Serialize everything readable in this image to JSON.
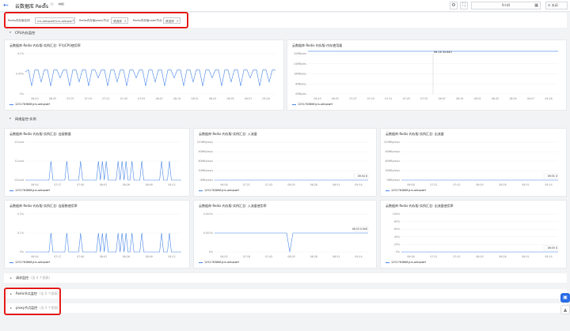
{
  "header": {
    "back_icon": "←",
    "title": "云数据库 Redis",
    "title_caret": "▾",
    "star_icon": "☆",
    "share_icon": "⋘",
    "settings_icon": "⚙",
    "fullscreen_icon": "⛶",
    "time_range": "9小时",
    "calendar_icon": "▦",
    "refresh_label": "关闭"
  },
  "filters": [
    {
      "label": "Redis内存版实例",
      "value": "crs-aetqxwtf(crs-aetqxw..."
    },
    {
      "label": "Redis内存版proxy节点",
      "value": "请选择"
    },
    {
      "label": "Redis内存版node节点",
      "value": "请选择"
    }
  ],
  "sections": {
    "cpu": {
      "title": "CPU内存监控",
      "arrow": "▾"
    },
    "net": {
      "title": "网络监控-实例",
      "arrow": "▾"
    },
    "request": {
      "title": "请求监控",
      "hint": "(含 4 个图表)",
      "arrow": "▸"
    },
    "redis_node": {
      "title": "Redis节点监控",
      "hint": "(含 0 个图表)",
      "arrow": "▸"
    },
    "proxy_node": {
      "title": "proxy节点监控",
      "hint": "(含 0 个图表)",
      "arrow": "▸"
    }
  },
  "legend_label": "1251763868|crs-aetqxwtf",
  "colors": {
    "line": "#4e8ae8",
    "accent": "#2b6de5",
    "red": "#e5221e"
  },
  "chart_data": [
    {
      "id": "c1",
      "type": "line",
      "title": "云数据库-Redis-内存版-实例汇总: 平均CPU使用率",
      "yticks": [
        "0%",
        "0.05%",
        "0.1%"
      ],
      "ylim": [
        0,
        0.1
      ],
      "xticks": [
        "06:43",
        "06:55",
        "07:07",
        "07:19",
        "07:31",
        "07:43",
        "07:55",
        "08:07",
        "08:19",
        "08:31",
        "08:43",
        "08:55",
        "09:07",
        "09:18"
      ],
      "series": [
        {
          "values": [
            0.055,
            0.06,
            0.02,
            0.06,
            0.06,
            0.03,
            0.06,
            0.06,
            0.02,
            0.06,
            0.06,
            0.04,
            0.06,
            0.06,
            0.02,
            0.06,
            0.06,
            0.03,
            0.06,
            0.06,
            0.02,
            0.06,
            0.06,
            0.04,
            0.06,
            0.06,
            0.02,
            0.06,
            0.06,
            0.03,
            0.06,
            0.06,
            0.02,
            0.06,
            0.06,
            0.04,
            0.06,
            0.06,
            0.02,
            0.06,
            0.06,
            0.03,
            0.06,
            0.06,
            0.02,
            0.06,
            0.06,
            0.04,
            0.06,
            0.06,
            0.02,
            0.06,
            0.06,
            0.03,
            0.06,
            0.06,
            0.02,
            0.06,
            0.06,
            0.04,
            0.06,
            0.06,
            0.02,
            0.06,
            0.06,
            0.03,
            0.06,
            0.06,
            0.02,
            0.06,
            0.06,
            0.04,
            0.06,
            0.06,
            0.02,
            0.06,
            0.06,
            0.03,
            0.06,
            0.06
          ]
        }
      ]
    },
    {
      "id": "c2",
      "type": "line",
      "title": "云数据库-Redis-内存版-内存使用量",
      "yticks": [
        "0MBytes",
        "8MBytes",
        "16MBytes",
        "24MBytes",
        "32MBytes"
      ],
      "ylim": [
        0,
        32
      ],
      "xticks": [
        "06:43",
        "06:55",
        "07:07",
        "07:19",
        "07:31",
        "07:43",
        "07:55",
        "08:07",
        "08:19",
        "08:31",
        "08:43",
        "08:55",
        "09:07",
        "09:18"
      ],
      "tooltip": "08:18 34.840",
      "cursor_x": 0.5,
      "series": [
        {
          "values": [
            34.8,
            34.8,
            34.8,
            34.8,
            34.8,
            34.8,
            34.8,
            34.8,
            34.8,
            34.8,
            34.8,
            34.8,
            34.8,
            34.8,
            34.8,
            34.8,
            34.8,
            34.8,
            34.8,
            34.8
          ]
        }
      ]
    },
    {
      "id": "c3",
      "type": "line",
      "title": "云数据库-Redis-内存版-实例汇总: 连接数量",
      "yticks": [
        "0Count",
        "1Count",
        "2Count"
      ],
      "ylim": [
        0,
        2
      ],
      "xticks": [
        "06:54",
        "07:17",
        "07:40",
        "08:03",
        "08:26",
        "08:49",
        "09:12"
      ],
      "series": [
        {
          "values": [
            0,
            0,
            0,
            0,
            0,
            0,
            0,
            0,
            0,
            0,
            0,
            0,
            0,
            1,
            0,
            0,
            0,
            0,
            0,
            0,
            0,
            1,
            0,
            0,
            0,
            0,
            0,
            0,
            1,
            0,
            0,
            0,
            0,
            0,
            0,
            0,
            0,
            1,
            0,
            1,
            0,
            1,
            0,
            0,
            0,
            0,
            0,
            1,
            0,
            1,
            0,
            1,
            0,
            0,
            1,
            0,
            0,
            0,
            0,
            1,
            0,
            0,
            0,
            0,
            0,
            0,
            0,
            0,
            0,
            1,
            0,
            0,
            0,
            1,
            0,
            0,
            0,
            0,
            0,
            0
          ]
        }
      ]
    },
    {
      "id": "c4",
      "type": "line",
      "title": "云数据库-Redis-内存版-实例汇总: 入流量",
      "yticks": [
        "0MBytes/s",
        "30MBytes/s",
        "60MBytes/s",
        "90MBytes/s",
        "120MBytes/s"
      ],
      "ylim": [
        0,
        120
      ],
      "xticks": [
        "06:58",
        "07:21",
        "07:42",
        "08:05",
        "08:28",
        "08:51",
        "09:14"
      ],
      "end_label": "09:34 0",
      "series": [
        {
          "values": [
            0,
            0,
            0,
            0,
            0,
            0,
            0,
            0,
            0,
            0,
            0,
            0,
            0,
            0,
            0,
            0,
            0,
            0,
            0,
            0
          ]
        }
      ]
    },
    {
      "id": "c5",
      "type": "line",
      "title": "云数据库-Redis-内存版-实例汇总: 出流量",
      "yticks": [
        "0MBytes/s",
        "30MBytes/s",
        "60MBytes/s",
        "90MBytes/s",
        "120MBytes/s"
      ],
      "ylim": [
        0,
        120
      ],
      "xticks": [
        "06:58",
        "07:21",
        "07:42",
        "08:05",
        "08:28",
        "08:51",
        "09:14"
      ],
      "end_label": "09:31 0",
      "series": [
        {
          "values": [
            0,
            0,
            0,
            0,
            0,
            0,
            0,
            0,
            0,
            0,
            0,
            0,
            0,
            0,
            0,
            0,
            0,
            0,
            0,
            0
          ]
        }
      ]
    },
    {
      "id": "c6",
      "type": "line",
      "title": "云数据库-Redis-内存版-实例汇总: 连接数使用率",
      "yticks": [
        "0%",
        "0.1%",
        "0.2%"
      ],
      "ylim": [
        0,
        0.2
      ],
      "xticks": [
        "06:54",
        "07:17",
        "07:40",
        "08:03",
        "08:26",
        "08:49",
        "09:12"
      ],
      "series": [
        {
          "values": [
            0,
            0,
            0,
            0,
            0,
            0,
            0,
            0,
            0,
            0,
            0,
            0,
            0,
            0.1,
            0,
            0,
            0,
            0,
            0,
            0,
            0,
            0.1,
            0,
            0,
            0,
            0,
            0,
            0,
            0.1,
            0,
            0,
            0,
            0,
            0,
            0,
            0,
            0,
            0.1,
            0,
            0.1,
            0,
            0.1,
            0,
            0,
            0,
            0,
            0,
            0.1,
            0,
            0.1,
            0,
            0.1,
            0,
            0,
            0.1,
            0,
            0,
            0,
            0,
            0.1,
            0,
            0,
            0,
            0,
            0,
            0,
            0,
            0,
            0,
            0.1,
            0,
            0,
            0,
            0.1,
            0,
            0,
            0,
            0,
            0,
            0
          ]
        }
      ]
    },
    {
      "id": "c7",
      "type": "line",
      "title": "云数据库-Redis-内存版-实例汇总: 入流量使用率",
      "yticks": [
        "0%",
        "0.001%",
        "0.002%"
      ],
      "ylim": [
        0,
        0.002
      ],
      "xticks": [
        "06:55",
        "07:18",
        "07:42",
        "08:05",
        "08:28",
        "08:51",
        "09:14"
      ],
      "end_label": "09:33 0.000",
      "series": [
        {
          "values": [
            0.001,
            0.001,
            0.001,
            0.001,
            0.001,
            0.001,
            0.001,
            0.001,
            0.001,
            0.001,
            0.001,
            0.001,
            0.001,
            0.001,
            0.001,
            0.001,
            0.001,
            0.001,
            0.001,
            0.001,
            0.001,
            0.001,
            0.001,
            0.001,
            0,
            0.001,
            0.001,
            0.001,
            0.001,
            0.001,
            0.001,
            0.001,
            0.001,
            0.001,
            0.001,
            0.001,
            0.001,
            0.001,
            0.001,
            0.001,
            0.001,
            0.001,
            0.001,
            0.001,
            0.001,
            0.001,
            0.001,
            0.001,
            0.001,
            0.001
          ]
        }
      ]
    },
    {
      "id": "c8",
      "type": "line",
      "title": "云数据库-Redis-内存版-实例汇总: 出流量使用率",
      "yticks": [
        "0%",
        "20%",
        "40%",
        "60%",
        "80%",
        "100%"
      ],
      "ylim": [
        0,
        100
      ],
      "xticks": [
        "06:58",
        "07:21",
        "07:42",
        "08:05",
        "08:28",
        "08:51",
        "09:14"
      ],
      "end_label": "09:33 0",
      "series": [
        {
          "values": [
            0,
            0,
            0,
            0,
            0,
            0,
            0,
            0,
            0,
            0,
            0,
            0,
            0,
            0,
            0,
            0,
            0,
            0,
            0,
            0
          ]
        }
      ]
    }
  ],
  "fab_icons": [
    "▣",
    "▲"
  ]
}
